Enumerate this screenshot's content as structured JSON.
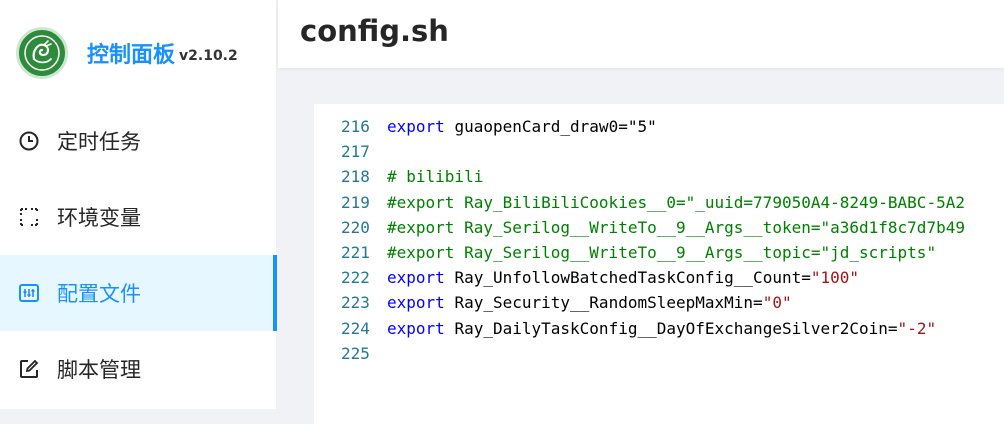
{
  "app": {
    "brand": "控制面板",
    "version": "v2.10.2"
  },
  "menu": [
    {
      "label": "定时任务",
      "icon": "clock-icon"
    },
    {
      "label": "环境变量",
      "icon": "variable-icon"
    },
    {
      "label": "配置文件",
      "icon": "config-icon",
      "active": true
    },
    {
      "label": "脚本管理",
      "icon": "edit-icon"
    }
  ],
  "page": {
    "title": "config.sh"
  },
  "editor": {
    "lines": [
      {
        "num": "216",
        "parts": [
          {
            "t": "export ",
            "c": "kw"
          },
          {
            "t": "guaopenCard_draw0=\"5\"",
            "c": "id"
          }
        ]
      },
      {
        "num": "217",
        "parts": []
      },
      {
        "num": "218",
        "parts": [
          {
            "t": "# bilibili",
            "c": "cm"
          }
        ]
      },
      {
        "num": "219",
        "parts": [
          {
            "t": "#export Ray_BiliBiliCookies__0=\"_uuid=779050A4-8249-BABC-5A2",
            "c": "cm"
          }
        ]
      },
      {
        "num": "220",
        "parts": [
          {
            "t": "#export Ray_Serilog__WriteTo__9__Args__token=\"a36d1f8c7d7b49",
            "c": "cm"
          }
        ]
      },
      {
        "num": "221",
        "parts": [
          {
            "t": "#export Ray_Serilog__WriteTo__9__Args__topic=\"jd_scripts\"",
            "c": "cm"
          }
        ]
      },
      {
        "num": "222",
        "parts": [
          {
            "t": "export ",
            "c": "kw"
          },
          {
            "t": "Ray_UnfollowBatchedTaskConfig__Count=",
            "c": "id"
          },
          {
            "t": "\"100\"",
            "c": "str"
          }
        ]
      },
      {
        "num": "223",
        "parts": [
          {
            "t": "export ",
            "c": "kw"
          },
          {
            "t": "Ray_Security__RandomSleepMaxMin=",
            "c": "id"
          },
          {
            "t": "\"0\"",
            "c": "str"
          }
        ]
      },
      {
        "num": "224",
        "parts": [
          {
            "t": "export ",
            "c": "kw"
          },
          {
            "t": "Ray_DailyTaskConfig__DayOfExchangeSilver2Coin=",
            "c": "id"
          },
          {
            "t": "\"-2\"",
            "c": "str"
          }
        ]
      },
      {
        "num": "225",
        "parts": []
      }
    ]
  },
  "colors": {
    "accent": "#1890ff",
    "active_bg": "#e6f7ff",
    "keyword": "#0000ff",
    "comment": "#008000",
    "string": "#a31515",
    "line_number": "#237893"
  }
}
